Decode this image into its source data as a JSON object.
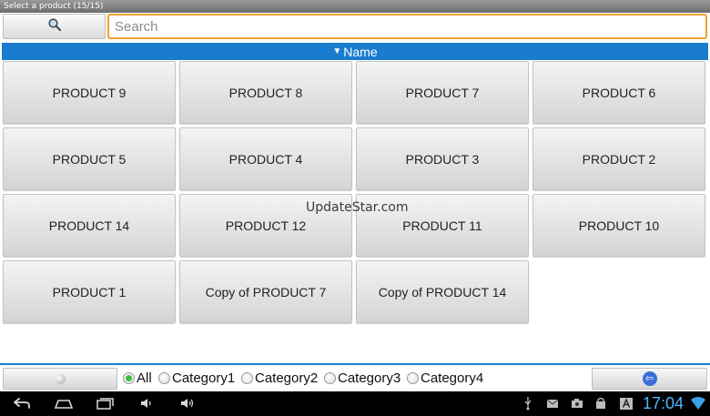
{
  "window": {
    "title": "Select a product (15/15)"
  },
  "search": {
    "placeholder": "Search",
    "value": ""
  },
  "sort": {
    "indicator": "▼",
    "label": "Name"
  },
  "products": [
    "PRODUCT 9",
    "PRODUCT 8",
    "PRODUCT 7",
    "PRODUCT 6",
    "PRODUCT 5",
    "PRODUCT 4",
    "PRODUCT 3",
    "PRODUCT 2",
    "PRODUCT 14",
    "PRODUCT 12",
    "PRODUCT 11",
    "PRODUCT 10",
    "PRODUCT 1",
    "Copy of PRODUCT 7",
    "Copy of PRODUCT 14"
  ],
  "watermark": "UpdateStar.com",
  "filters": [
    {
      "label": "All",
      "selected": true
    },
    {
      "label": "Category1",
      "selected": false
    },
    {
      "label": "Category2",
      "selected": false
    },
    {
      "label": "Category3",
      "selected": false
    },
    {
      "label": "Category4",
      "selected": false
    }
  ],
  "statusbar": {
    "time": "17:04"
  },
  "colors": {
    "accent": "#1a7ccf",
    "search_border": "#f0a030",
    "clock": "#4fb8ff",
    "radio_on": "#3bbf3b"
  },
  "icons": [
    "search-icon",
    "back-arrow-icon",
    "nav-back-icon",
    "nav-home-icon",
    "nav-recents-icon",
    "volume-down-icon",
    "volume-up-icon",
    "usb-icon",
    "mail-icon",
    "camera-icon",
    "bag-icon",
    "font-icon",
    "wifi-icon"
  ]
}
